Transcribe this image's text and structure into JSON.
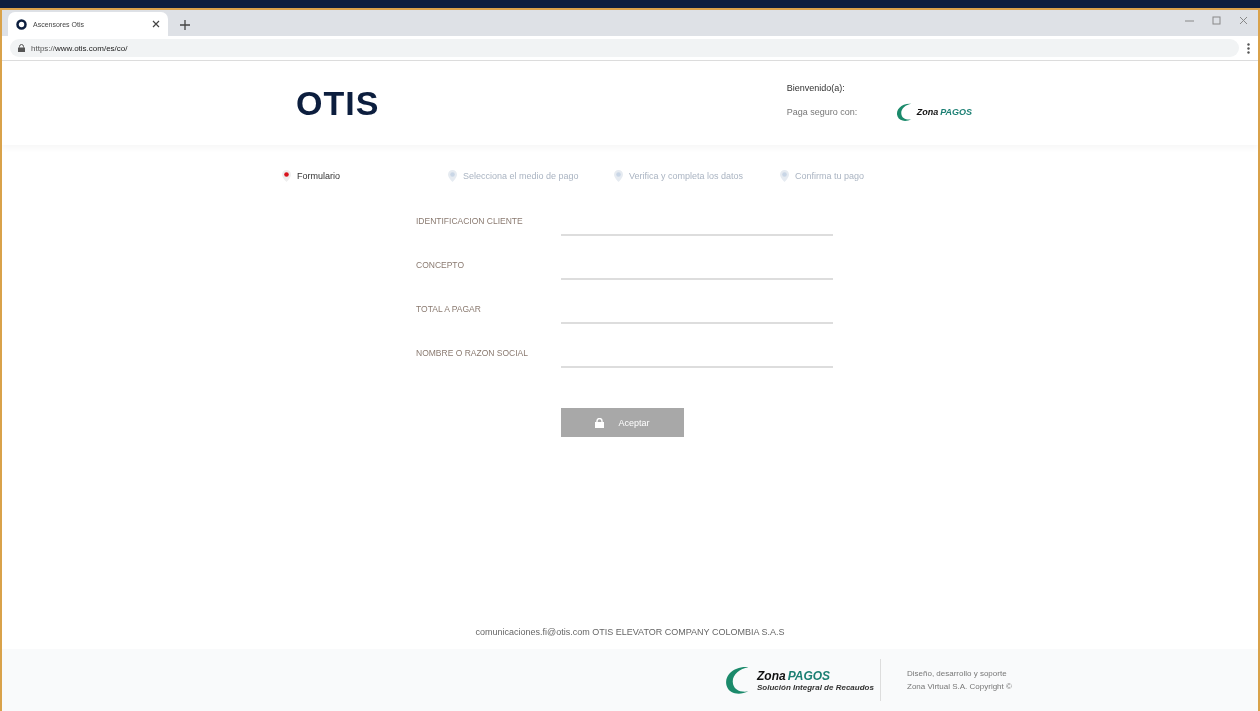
{
  "browser": {
    "tab_title": "Ascensores Otis",
    "url_scheme": "https://",
    "url_rest": "www.otis.com/es/co/"
  },
  "header": {
    "logo": "OTIS",
    "welcome": "Bienvenido(a):",
    "pay_with": "Paga seguro con:",
    "partner_logo": {
      "first": "Zona",
      "second": "PAGOS"
    }
  },
  "steps": [
    {
      "label": "Formulario",
      "selected": true
    },
    {
      "label": "Selecciona el medio de pago",
      "selected": false
    },
    {
      "label": "Verifica y completa los datos",
      "selected": false
    },
    {
      "label": "Confirma tu pago",
      "selected": false
    }
  ],
  "form": {
    "fields": [
      {
        "label": "IDENTIFICACION CLIENTE"
      },
      {
        "label": "CONCEPTO"
      },
      {
        "label": "TOTAL A PAGAR"
      },
      {
        "label": "NOMBRE O RAZON SOCIAL"
      }
    ],
    "submit": "Aceptar"
  },
  "contact": "comunicaciones.fi@otis.com OTIS ELEVATOR COMPANY COLOMBIA S.A.S",
  "footer": {
    "logo": {
      "first": "Zona",
      "second": "PAGOS",
      "tagline": "Solución Integral de Recaudos"
    },
    "credits": [
      "Diseño, desarrollo y soporte",
      "Zona Virtual S.A. Copyright ©"
    ]
  }
}
